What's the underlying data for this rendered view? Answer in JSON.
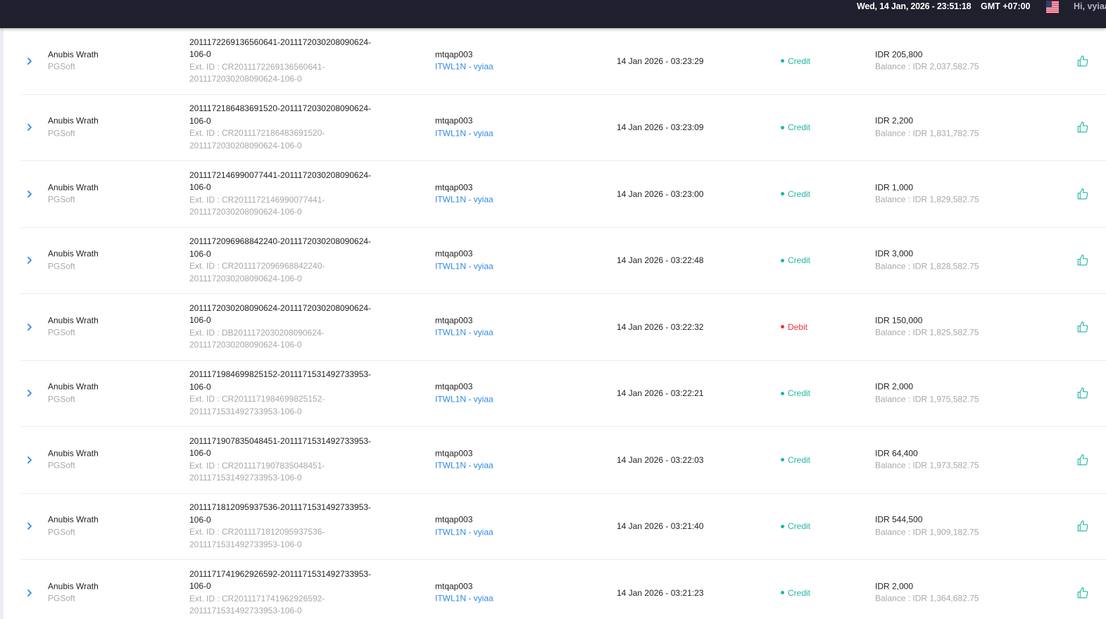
{
  "header": {
    "datetime": "Wed, 14 Jan, 2026 - 23:51:18",
    "timezone": "GMT +07:00",
    "greeting": "Hi, vyiaa"
  },
  "colors": {
    "credit": "#22b5a8",
    "debit": "#e8323c",
    "link": "#2f8be6",
    "header_bg": "#1f1f2e"
  },
  "icons": {
    "expand": "chevron-right-icon",
    "action": "thumbs-up-icon",
    "flag": "us-flag-icon"
  },
  "transactions": [
    {
      "game": "Anubis Wrath",
      "provider": "PGSoft",
      "id_line1": "2011172269136560641-2011172030208090624-",
      "id_line2": "106-0",
      "ext_line1": "Ext. ID : CR2011172269136560641-",
      "ext_line2": "2011172030208090624-106-0",
      "player": "mtqap003",
      "agent": "ITWL1N - vyiaa",
      "date": "14 Jan 2026 - 03:23:29",
      "type": "Credit",
      "amount": "IDR 205,800",
      "balance": "Balance : IDR 2,037,582.75"
    },
    {
      "game": "Anubis Wrath",
      "provider": "PGSoft",
      "id_line1": "2011172186483691520-2011172030208090624-",
      "id_line2": "106-0",
      "ext_line1": "Ext. ID : CR2011172186483691520-",
      "ext_line2": "2011172030208090624-106-0",
      "player": "mtqap003",
      "agent": "ITWL1N - vyiaa",
      "date": "14 Jan 2026 - 03:23:09",
      "type": "Credit",
      "amount": "IDR 2,200",
      "balance": "Balance : IDR 1,831,782.75"
    },
    {
      "game": "Anubis Wrath",
      "provider": "PGSoft",
      "id_line1": "2011172146990077441-2011172030208090624-",
      "id_line2": "106-0",
      "ext_line1": "Ext. ID : CR2011172146990077441-",
      "ext_line2": "2011172030208090624-106-0",
      "player": "mtqap003",
      "agent": "ITWL1N - vyiaa",
      "date": "14 Jan 2026 - 03:23:00",
      "type": "Credit",
      "amount": "IDR 1,000",
      "balance": "Balance : IDR 1,829,582.75"
    },
    {
      "game": "Anubis Wrath",
      "provider": "PGSoft",
      "id_line1": "2011172096968842240-2011172030208090624-",
      "id_line2": "106-0",
      "ext_line1": "Ext. ID : CR2011172096968842240-",
      "ext_line2": "2011172030208090624-106-0",
      "player": "mtqap003",
      "agent": "ITWL1N - vyiaa",
      "date": "14 Jan 2026 - 03:22:48",
      "type": "Credit",
      "amount": "IDR 3,000",
      "balance": "Balance : IDR 1,828,582.75"
    },
    {
      "game": "Anubis Wrath",
      "provider": "PGSoft",
      "id_line1": "2011172030208090624-2011172030208090624-",
      "id_line2": "106-0",
      "ext_line1": "Ext. ID : DB2011172030208090624-",
      "ext_line2": "2011172030208090624-106-0",
      "player": "mtqap003",
      "agent": "ITWL1N - vyiaa",
      "date": "14 Jan 2026 - 03:22:32",
      "type": "Debit",
      "amount": "IDR 150,000",
      "balance": "Balance : IDR 1,825,582.75"
    },
    {
      "game": "Anubis Wrath",
      "provider": "PGSoft",
      "id_line1": "2011171984699825152-2011171531492733953-",
      "id_line2": "106-0",
      "ext_line1": "Ext. ID : CR2011171984699825152-",
      "ext_line2": "2011171531492733953-106-0",
      "player": "mtqap003",
      "agent": "ITWL1N - vyiaa",
      "date": "14 Jan 2026 - 03:22:21",
      "type": "Credit",
      "amount": "IDR 2,000",
      "balance": "Balance : IDR 1,975,582.75"
    },
    {
      "game": "Anubis Wrath",
      "provider": "PGSoft",
      "id_line1": "2011171907835048451-2011171531492733953-",
      "id_line2": "106-0",
      "ext_line1": "Ext. ID : CR2011171907835048451-",
      "ext_line2": "2011171531492733953-106-0",
      "player": "mtqap003",
      "agent": "ITWL1N - vyiaa",
      "date": "14 Jan 2026 - 03:22:03",
      "type": "Credit",
      "amount": "IDR 64,400",
      "balance": "Balance : IDR 1,973,582.75"
    },
    {
      "game": "Anubis Wrath",
      "provider": "PGSoft",
      "id_line1": "2011171812095937536-2011171531492733953-",
      "id_line2": "106-0",
      "ext_line1": "Ext. ID : CR2011171812095937536-",
      "ext_line2": "2011171531492733953-106-0",
      "player": "mtqap003",
      "agent": "ITWL1N - vyiaa",
      "date": "14 Jan 2026 - 03:21:40",
      "type": "Credit",
      "amount": "IDR 544,500",
      "balance": "Balance : IDR 1,909,182.75"
    },
    {
      "game": "Anubis Wrath",
      "provider": "PGSoft",
      "id_line1": "2011171741962926592-2011171531492733953-",
      "id_line2": "106-0",
      "ext_line1": "Ext. ID : CR2011171741962926592-",
      "ext_line2": "2011171531492733953-106-0",
      "player": "mtqap003",
      "agent": "ITWL1N - vyiaa",
      "date": "14 Jan 2026 - 03:21:23",
      "type": "Credit",
      "amount": "IDR 2,000",
      "balance": "Balance : IDR 1,364,682.75"
    }
  ]
}
